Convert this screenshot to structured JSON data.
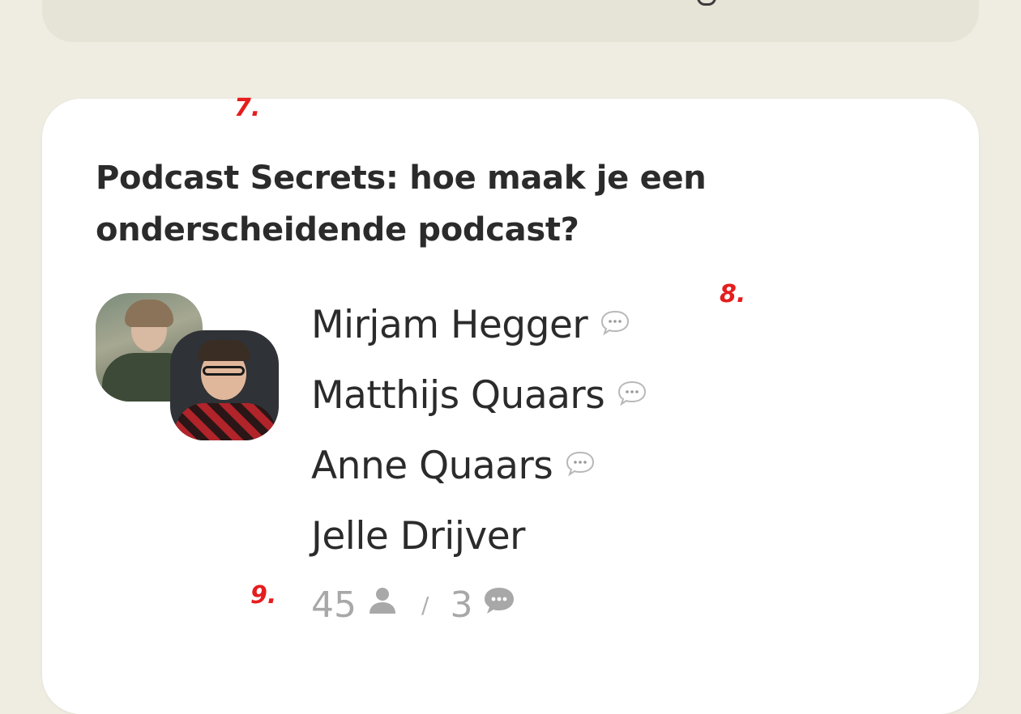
{
  "room": {
    "title": "Podcast Secrets: hoe maak je een onderscheidende podcast?",
    "speakers": [
      {
        "name": "Mirjam Hegger",
        "has_chat": true
      },
      {
        "name": "Matthijs Quaars",
        "has_chat": true
      },
      {
        "name": "Anne Quaars",
        "has_chat": true
      },
      {
        "name": "Jelle Drijver",
        "has_chat": false
      }
    ],
    "stats": {
      "listeners": "45",
      "separator": "/",
      "speakers_count": "3"
    }
  },
  "annotations": {
    "seven": "7.",
    "eight": "8.",
    "nine": "9."
  },
  "icons": {
    "speaker_chat": "chat-bubble-icon",
    "listeners": "person-icon",
    "speakers": "speech-bubble-icon"
  },
  "colors": {
    "page_background": "#efede2",
    "card_background": "#ffffff",
    "muted_text": "#a8a8a8",
    "annotation": "#e61d1d"
  }
}
